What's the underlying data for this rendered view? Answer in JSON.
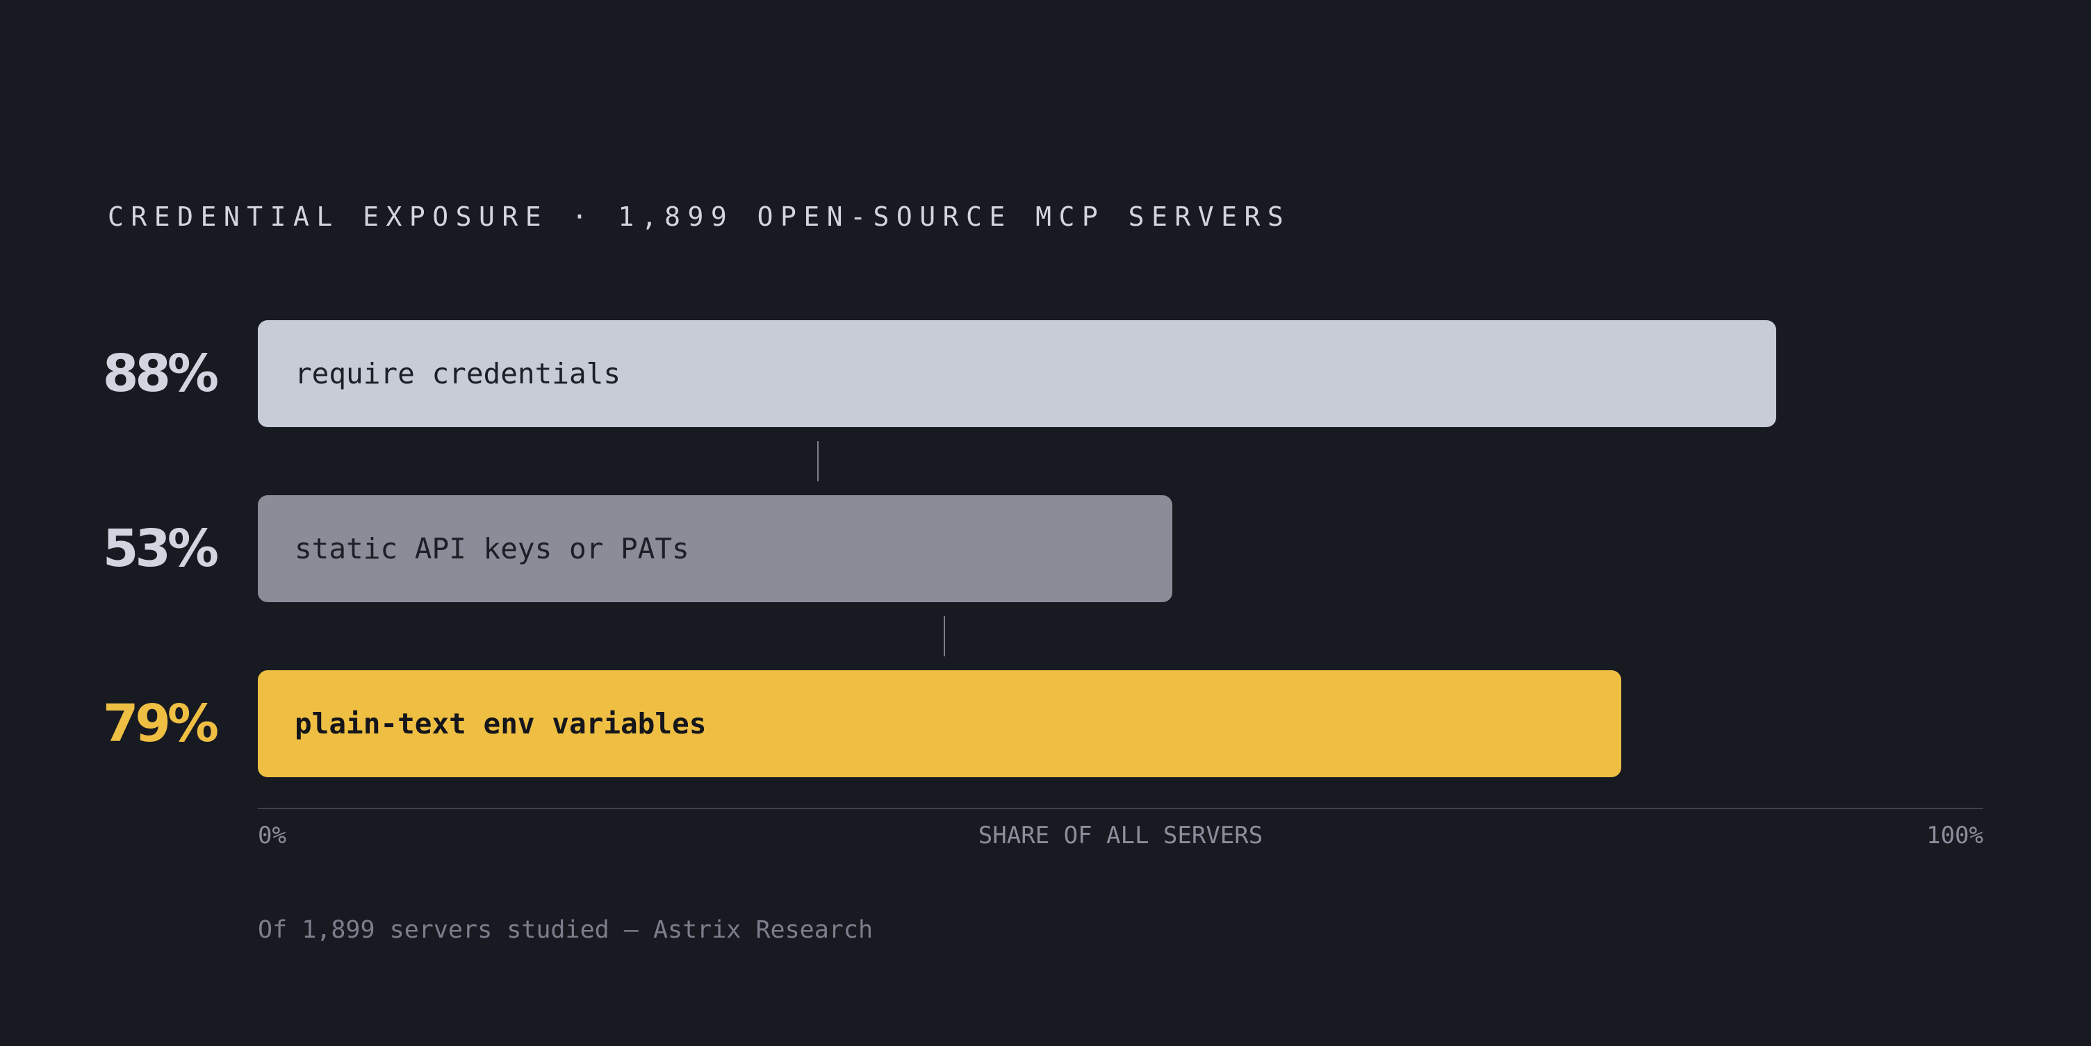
{
  "chart_data": {
    "type": "bar",
    "orientation": "horizontal",
    "title": "CREDENTIAL EXPOSURE · 1,899 OPEN-SOURCE MCP SERVERS",
    "categories": [
      "require credentials",
      "static API keys or PATs",
      "plain-text env variables"
    ],
    "values": [
      88,
      53,
      79
    ],
    "value_labels": [
      "88%",
      "53%",
      "79%"
    ],
    "bar_colors": [
      "#c8ccd7",
      "#8a8d98",
      "#efbf43"
    ],
    "label_colors": [
      "#d2d5df",
      "#d2d5df",
      "#efbf43"
    ],
    "highlight_index": 2,
    "xlabel": "SHARE OF ALL SERVERS",
    "xlim": [
      0,
      100
    ],
    "x_tick_labels": [
      "0%",
      "100%"
    ],
    "grid": false,
    "footnote": "Of 1,899 servers studied — Astrix Research"
  }
}
